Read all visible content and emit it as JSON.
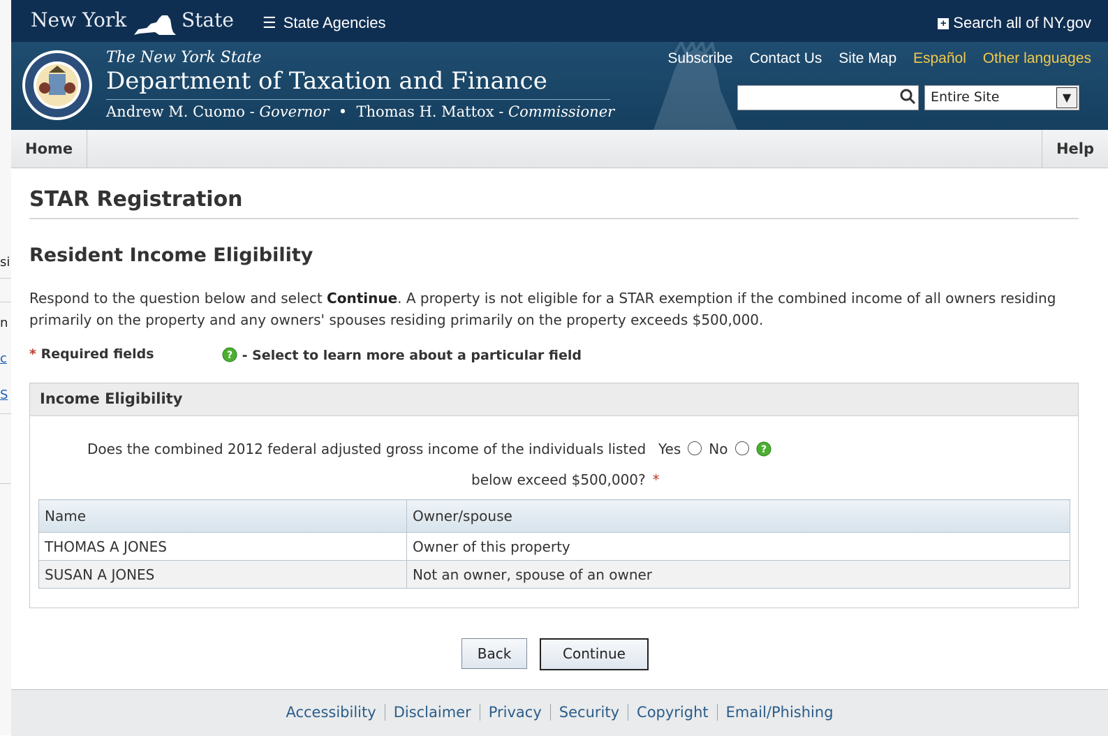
{
  "background_fragments": {
    "f1": "si",
    "f2": "n",
    "f3": "c",
    "f4": "S"
  },
  "topbar": {
    "nys_left": "New York",
    "nys_right": "State",
    "agencies_icon": "list-icon",
    "agencies_label": "State Agencies",
    "search_all_icon": "plus-box-icon",
    "search_all_label": "Search all of NY.gov"
  },
  "dept_header": {
    "line1": "The New York State",
    "line2": "Department of Taxation and Finance",
    "governor_name": "Andrew M. Cuomo -",
    "governor_title": "Governor",
    "separator": "•",
    "commissioner_name": "Thomas H. Mattox -",
    "commissioner_title": "Commissioner",
    "links": {
      "subscribe": "Subscribe",
      "contact": "Contact Us",
      "sitemap": "Site Map",
      "espanol": "Español",
      "other": "Other languages"
    },
    "search_value": "",
    "scope_select": "Entire Site"
  },
  "nav": {
    "home": "Home",
    "help": "Help"
  },
  "page": {
    "title": "STAR Registration",
    "section_title": "Resident Income Eligibility",
    "instructions_before": "Respond to the question below and select ",
    "instructions_bold": "Continue",
    "instructions_after": ". A property is not eligible for a STAR exemption if the combined income of all owners residing primarily on the property and any owners' spouses residing primarily on the property exceeds $500,000.",
    "required_star": "*",
    "required_label": "Required fields",
    "help_note": "- Select to learn more about a particular field"
  },
  "panel": {
    "header": "Income Eligibility",
    "question_line1": "Does the combined 2012 federal adjusted gross income of the individuals listed",
    "question_line2": "below exceed $500,000?",
    "required_star": "*",
    "yes_label": "Yes",
    "no_label": "No",
    "table": {
      "columns": [
        "Name",
        "Owner/spouse"
      ],
      "rows": [
        [
          "THOMAS A JONES",
          "Owner of this property"
        ],
        [
          "SUSAN A JONES",
          "Not an owner, spouse of an owner"
        ]
      ]
    }
  },
  "buttons": {
    "back": "Back",
    "continue": "Continue"
  },
  "footer": {
    "links": [
      "Accessibility",
      "Disclaimer",
      "Privacy",
      "Security",
      "Copyright",
      "Email/Phishing"
    ]
  },
  "colors": {
    "topbar": "#0f2f52",
    "header": "#1f4d70",
    "gold_link": "#f2c94c",
    "required_star": "#c0392b",
    "footer_link": "#2b5c8a"
  }
}
